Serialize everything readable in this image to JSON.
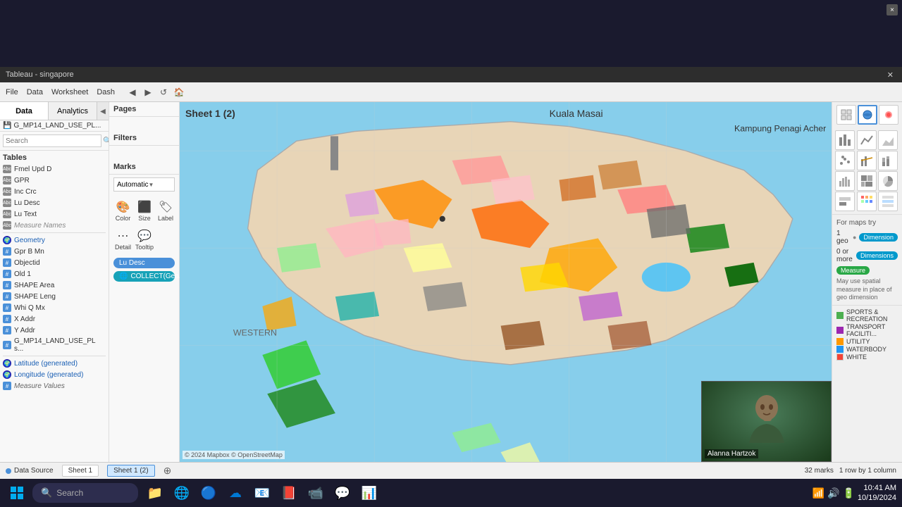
{
  "window": {
    "title": "Tableau - singapore",
    "close_label": "×"
  },
  "toolbar": {
    "menus": [
      "File",
      "Data",
      "Worksheet",
      "Dash"
    ],
    "back_label": "←",
    "forward_label": "→"
  },
  "left_panel": {
    "data_tab": "Data",
    "analytics_tab": "Analytics",
    "dataset": "G_MP14_LAND_USE_PL...",
    "search_placeholder": "Search",
    "tables_label": "Tables",
    "tables": [
      {
        "name": "Fmel Upd D",
        "type": "abc"
      },
      {
        "name": "GPR",
        "type": "abc"
      },
      {
        "name": "Inc Crc",
        "type": "abc"
      },
      {
        "name": "Lu Desc",
        "type": "abc"
      },
      {
        "name": "Lu Text",
        "type": "abc"
      },
      {
        "name": "Measure Names",
        "type": "abc",
        "italic": true
      },
      {
        "name": "Geometry",
        "type": "globe"
      },
      {
        "name": "Gpr B Mn",
        "type": "hash"
      },
      {
        "name": "Objectid",
        "type": "hash"
      },
      {
        "name": "Old 1",
        "type": "hash"
      },
      {
        "name": "SHAPE Area",
        "type": "hash"
      },
      {
        "name": "SHAPE Leng",
        "type": "hash"
      },
      {
        "name": "Whi Q Mx",
        "type": "hash"
      },
      {
        "name": "X Addr",
        "type": "hash"
      },
      {
        "name": "Y Addr",
        "type": "hash"
      },
      {
        "name": "G_MP14_LAND_USE_PL s...",
        "type": "hash"
      },
      {
        "name": "Latitude (generated)",
        "type": "globe"
      },
      {
        "name": "Longitude (generated)",
        "type": "globe"
      },
      {
        "name": "Measure Values",
        "type": "hash",
        "italic": true
      }
    ]
  },
  "pages_label": "Pages",
  "filters_label": "Filters",
  "marks": {
    "label": "Marks",
    "dropdown_label": "Automatic",
    "buttons": [
      {
        "icon": "🎨",
        "label": "Color"
      },
      {
        "icon": "⬛",
        "label": "Size"
      },
      {
        "icon": "🏷",
        "label": "Label"
      },
      {
        "icon": "⋯",
        "label": "Detail"
      },
      {
        "icon": "💬",
        "label": "Tooltip"
      }
    ],
    "pill1": "Lu Desc",
    "pill2": "COLLECT(Geo..."
  },
  "sheet": {
    "title": "Sheet 1 (2)"
  },
  "map": {
    "attribution": "© 2024 Mapbox © OpenStreetMap"
  },
  "for_maps": {
    "title": "For maps try",
    "row1_label": "1 geo",
    "row1_pill": "Dimension",
    "row2_label": "0 or more",
    "row2_pill": "Dimensions",
    "row3_pill": "Measure",
    "note": "May use spatial measure in place of geo dimension"
  },
  "legend": {
    "items": [
      {
        "color": "#4caf50",
        "label": "SPORTS & RECREATION"
      },
      {
        "color": "#9c27b0",
        "label": "TRANSPORT FACILITI..."
      },
      {
        "color": "#ff9800",
        "label": "UTILITY"
      },
      {
        "color": "#2196f3",
        "label": "WATERBODY"
      },
      {
        "color": "#f44336",
        "label": "WHITE"
      }
    ]
  },
  "webcam": {
    "person_name": "Alanna Hartzok"
  },
  "status_bar": {
    "source": "Data Source",
    "sheet1": "Sheet 1",
    "sheet1_2": "Sheet 1 (2)",
    "marks_count": "32 marks",
    "rows_cols": "1 row by 1 column"
  },
  "taskbar": {
    "search_text": "Search",
    "time": "10:41 AM",
    "date": "10/19/2024",
    "apps": [
      "🗂",
      "🔍",
      "📁",
      "🌐",
      "🔵",
      "🔴",
      "🟠",
      "⚡",
      "📕",
      "🔮",
      "🔒",
      "📊"
    ]
  }
}
